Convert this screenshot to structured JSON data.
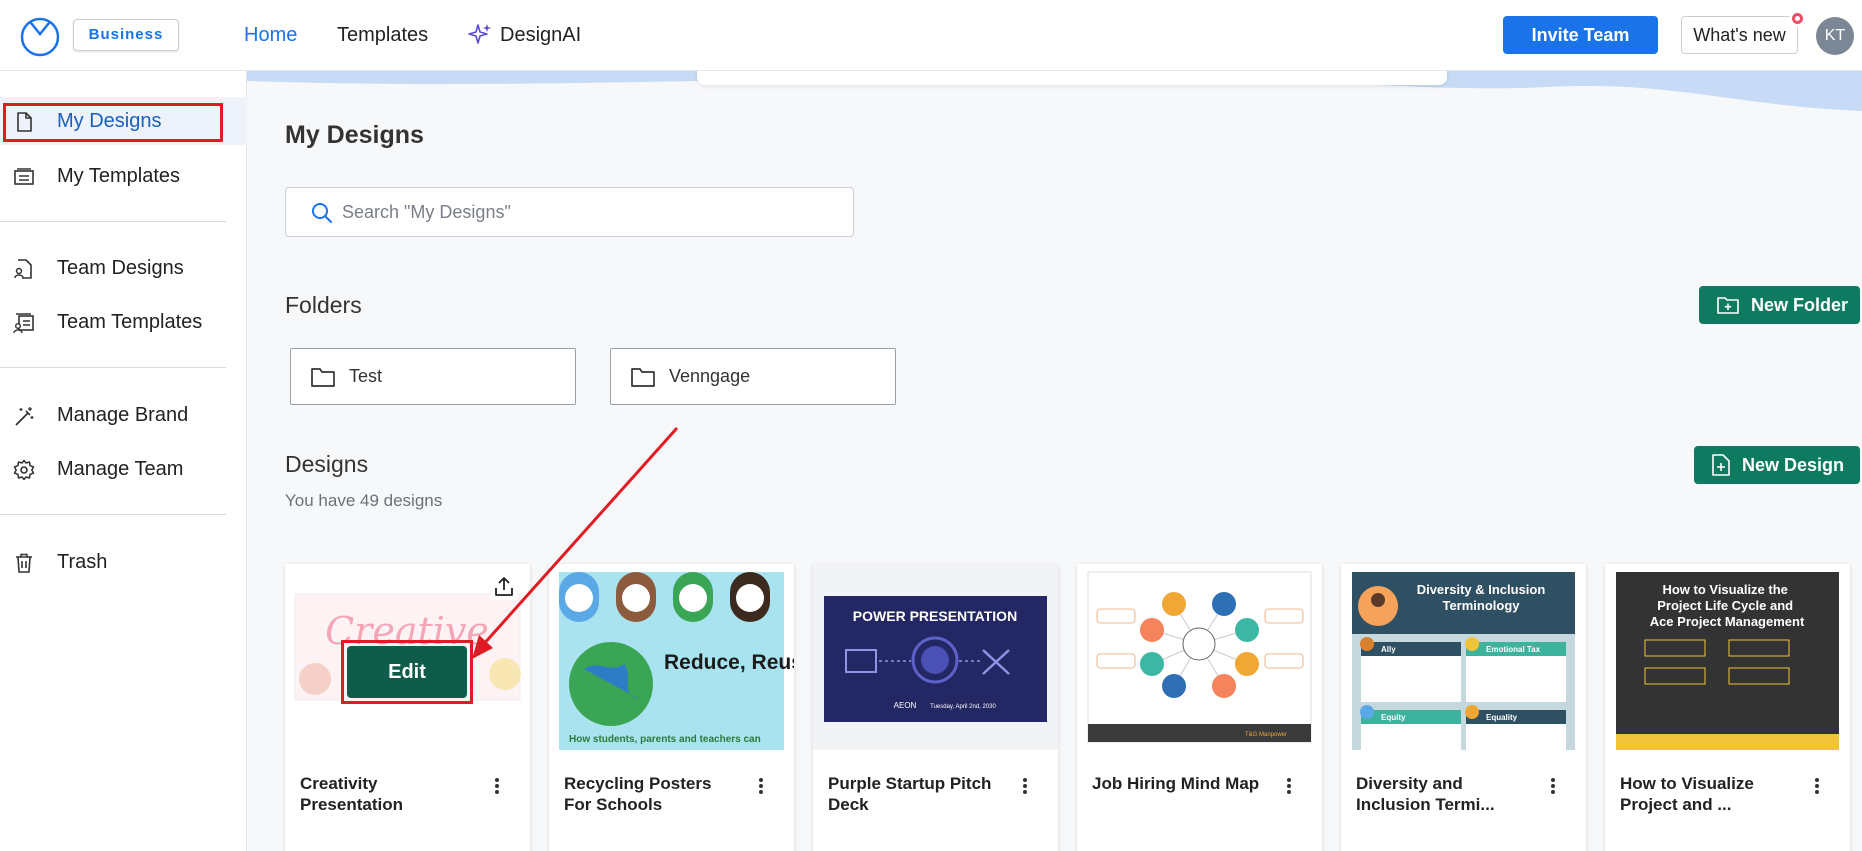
{
  "app": {
    "plan_badge": "Business",
    "nav": {
      "home": "Home",
      "templates": "Templates",
      "designai": "DesignAI"
    },
    "invite_label": "Invite Team",
    "whats_new_label": "What's new",
    "avatar_initials": "KT",
    "accent_color": "#1a73e8",
    "green_color": "#0e7a60",
    "highlight_color": "#e01b24"
  },
  "sidebar": {
    "items": [
      {
        "label": "My Designs",
        "icon": "document-icon",
        "active": true
      },
      {
        "label": "My Templates",
        "icon": "template-icon"
      },
      {
        "label": "Team Designs",
        "icon": "team-document-icon"
      },
      {
        "label": "Team Templates",
        "icon": "team-template-icon"
      },
      {
        "label": "Manage Brand",
        "icon": "magic-wand-icon"
      },
      {
        "label": "Manage Team",
        "icon": "gear-icon"
      },
      {
        "label": "Trash",
        "icon": "trash-icon"
      }
    ]
  },
  "main": {
    "title": "My Designs",
    "search_placeholder": "Search \"My Designs\"",
    "folders_title": "Folders",
    "new_folder_label": "New Folder",
    "folders": [
      {
        "name": "Test"
      },
      {
        "name": "Venngage"
      }
    ],
    "designs_title": "Designs",
    "designs_count_text": "You have 49 designs",
    "new_design_label": "New Design",
    "edit_label": "Edit",
    "designs": [
      {
        "title": "Creativity Presentation"
      },
      {
        "title": "Recycling Posters For Schools"
      },
      {
        "title": "Purple Startup Pitch Deck"
      },
      {
        "title": "Job Hiring Mind Map"
      },
      {
        "title": "Diversity and Inclusion Termi..."
      },
      {
        "title": "How to Visualize Project and ..."
      }
    ]
  },
  "thumbs": {
    "creative_word": "Creative",
    "recycle_text": "Reduce, Reuse, Recycle!",
    "recycle_footer": "How students, parents and teachers can",
    "pitch_title": "POWER PRESENTATION",
    "pitch_footer": "AEON",
    "pitch_date": "Tuesday, April 2nd, 2030",
    "mindmap_footer": "T&G Manpower",
    "diversity_heading": "Diversity & Inclusion Terminology",
    "diversity_terms": [
      "Ally",
      "Emotional Tax",
      "Equity",
      "Equality"
    ],
    "project_heading": "How to Visualize the Project Life Cycle and Ace Project Management"
  }
}
